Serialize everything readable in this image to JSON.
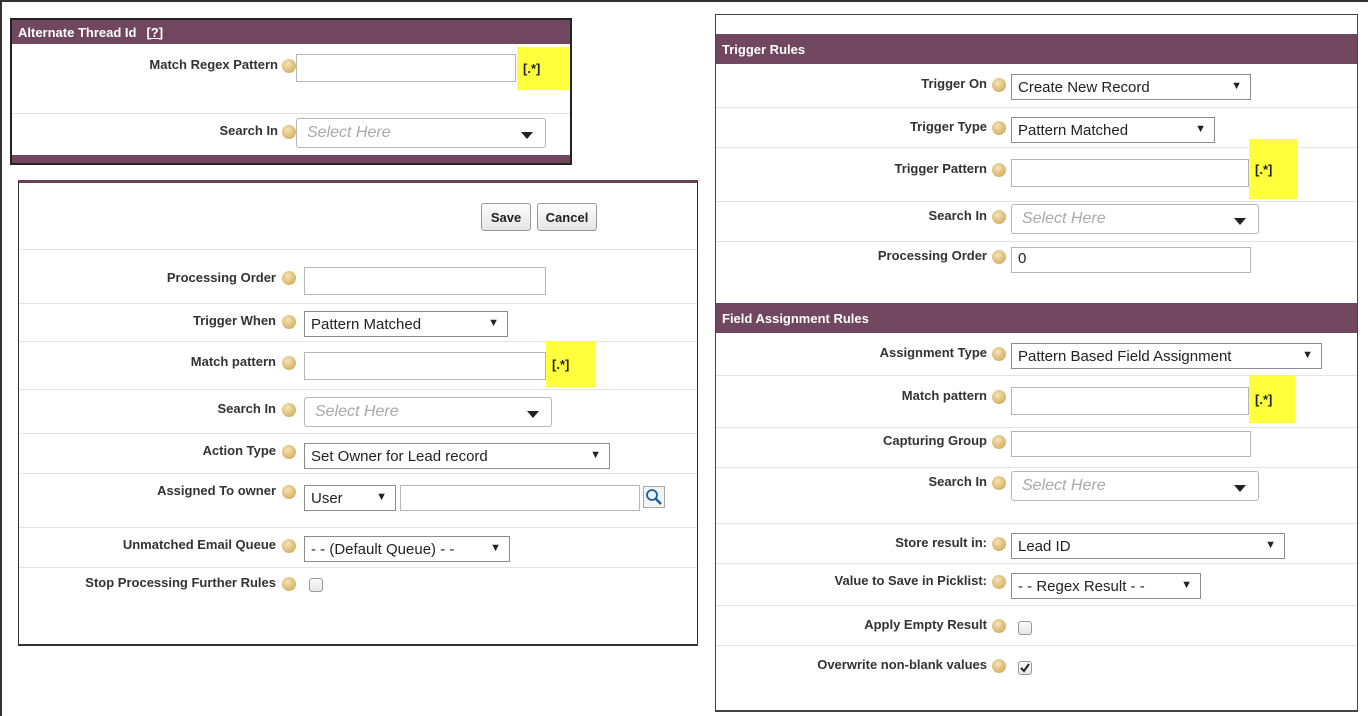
{
  "alt_thread": {
    "title": "Alternate Thread Id",
    "help_link": "[?]",
    "match_label": "Match Regex Pattern",
    "match_value": "",
    "regex_hint": "[.*]",
    "search_label": "Search In",
    "search_placeholder": "Select Here"
  },
  "rule_form": {
    "save_label": "Save",
    "cancel_label": "Cancel",
    "processing_order_label": "Processing Order",
    "processing_order_value": "",
    "trigger_when_label": "Trigger When",
    "trigger_when_value": "Pattern Matched",
    "match_pattern_label": "Match pattern",
    "match_pattern_value": "",
    "regex_hint": "[.*]",
    "search_in_label": "Search In",
    "search_in_placeholder": "Select Here",
    "action_type_label": "Action Type",
    "action_type_value": "Set Owner for Lead record",
    "assigned_owner_label": "Assigned To owner",
    "owner_type_value": "User",
    "owner_value": "",
    "unmatched_queue_label": "Unmatched Email Queue",
    "unmatched_queue_value": "- - (Default Queue) - -",
    "stop_processing_label": "Stop Processing Further Rules",
    "stop_processing_checked": false
  },
  "trigger_rules": {
    "title": "Trigger Rules",
    "trigger_on_label": "Trigger On",
    "trigger_on_value": "Create New Record",
    "trigger_type_label": "Trigger Type",
    "trigger_type_value": "Pattern Matched",
    "trigger_pattern_label": "Trigger Pattern",
    "trigger_pattern_value": "",
    "regex_hint": "[.*]",
    "search_in_label": "Search In",
    "search_in_placeholder": "Select Here",
    "processing_order_label": "Processing Order",
    "processing_order_value": "0"
  },
  "field_assignment": {
    "title": "Field Assignment Rules",
    "assignment_type_label": "Assignment Type",
    "assignment_type_value": "Pattern Based Field Assignment",
    "match_pattern_label": "Match pattern",
    "match_pattern_value": "",
    "regex_hint": "[.*]",
    "capturing_group_label": "Capturing Group",
    "capturing_group_value": "",
    "search_in_label": "Search In",
    "search_in_placeholder": "Select Here",
    "store_result_label": "Store result in:",
    "store_result_value": "Lead ID",
    "picklist_label": "Value to Save in Picklist:",
    "picklist_value": "- - Regex Result - -",
    "apply_empty_label": "Apply Empty Result",
    "apply_empty_checked": false,
    "overwrite_label": "Overwrite non-blank values",
    "overwrite_checked": true
  },
  "colors": {
    "header": "#71475f",
    "highlight": "#ffff3b",
    "help_icon": "#d8b365"
  },
  "icons": [
    "help-icon",
    "lookup-magnifier-icon",
    "dropdown-arrow-icon",
    "checkmark-icon"
  ]
}
